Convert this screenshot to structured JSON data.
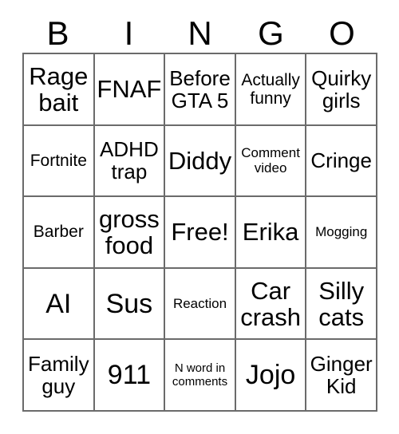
{
  "card": {
    "title": "BINGO",
    "header_letters": [
      "B",
      "I",
      "N",
      "G",
      "O"
    ],
    "free_space_label": "Free!",
    "colors": {
      "background": "#ffffff",
      "border": "#6b6b6b",
      "text": "#000000"
    },
    "rows": [
      [
        {
          "text": "Rage\nbait",
          "size": "lg"
        },
        {
          "text": "FNAF",
          "size": "lg"
        },
        {
          "text": "Before\nGTA 5",
          "size": "md"
        },
        {
          "text": "Actually\nfunny",
          "size": "sm"
        },
        {
          "text": "Quirky\ngirls",
          "size": "md"
        }
      ],
      [
        {
          "text": "Fortnite",
          "size": "sm"
        },
        {
          "text": "ADHD\ntrap",
          "size": "md"
        },
        {
          "text": "Diddy",
          "size": "lg"
        },
        {
          "text": "Comment\nvideo",
          "size": "xs"
        },
        {
          "text": "Cringe",
          "size": "md"
        }
      ],
      [
        {
          "text": "Barber",
          "size": "sm"
        },
        {
          "text": "gross\nfood",
          "size": "lg"
        },
        {
          "text": "Free!",
          "size": "lg"
        },
        {
          "text": "Erika",
          "size": "lg"
        },
        {
          "text": "Mogging",
          "size": "xs"
        }
      ],
      [
        {
          "text": "AI",
          "size": "xl"
        },
        {
          "text": "Sus",
          "size": "xl"
        },
        {
          "text": "Reaction",
          "size": "xs"
        },
        {
          "text": "Car\ncrash",
          "size": "lg"
        },
        {
          "text": "Silly\ncats",
          "size": "lg"
        }
      ],
      [
        {
          "text": "Family\nguy",
          "size": "md"
        },
        {
          "text": "911",
          "size": "xl"
        },
        {
          "text": "N word in\ncomments",
          "size": "xxs"
        },
        {
          "text": "Jojo",
          "size": "xl"
        },
        {
          "text": "Ginger\nKid",
          "size": "md"
        }
      ]
    ]
  }
}
